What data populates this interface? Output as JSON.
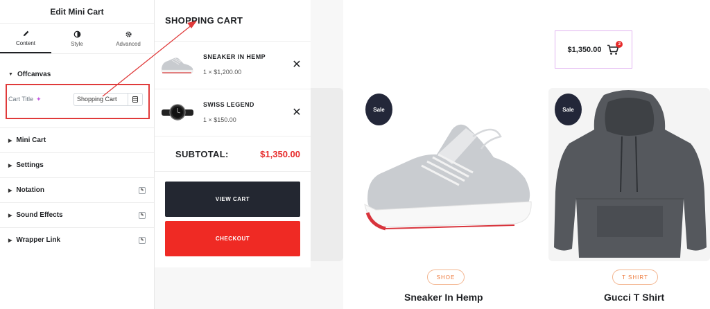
{
  "editor": {
    "title": "Edit Mini Cart",
    "tabs": [
      {
        "label": "Content",
        "icon": "pencil-icon"
      },
      {
        "label": "Style",
        "icon": "half-circle-icon"
      },
      {
        "label": "Advanced",
        "icon": "gear-icon"
      }
    ],
    "open_section": "Offcanvas",
    "cart_title_label": "Cart Title",
    "cart_title_value": "Shopping Cart",
    "sections": [
      "Mini Cart",
      "Settings",
      "Notation",
      "Sound Effects",
      "Wrapper Link"
    ]
  },
  "cart": {
    "title": "SHOPPING CART",
    "items": [
      {
        "name": "SNEAKER IN HEMP",
        "qty": "1 × $1,200.00"
      },
      {
        "name": "SWISS LEGEND",
        "qty": "1 × $150.00"
      }
    ],
    "remove": "✕",
    "subtotal_label": "SUBTOTAL:",
    "subtotal_value": "$1,350.00",
    "view_cart": "VIEW CART",
    "checkout": "CHECKOUT"
  },
  "mini_cart_widget": {
    "amount": "$1,350.00",
    "count": "2"
  },
  "products": [
    {
      "badge": "Sale",
      "category": "SHOE",
      "name": "Sneaker In Hemp"
    },
    {
      "badge": "Sale",
      "category": "T SHIRT",
      "name": "Gucci T Shirt"
    }
  ],
  "colors": {
    "accent_red": "#e62a2a",
    "dark": "#232731",
    "highlight_box": "#e03a3a",
    "widget_border": "#e1b3f0",
    "category_orange": "#ee7b3e"
  }
}
